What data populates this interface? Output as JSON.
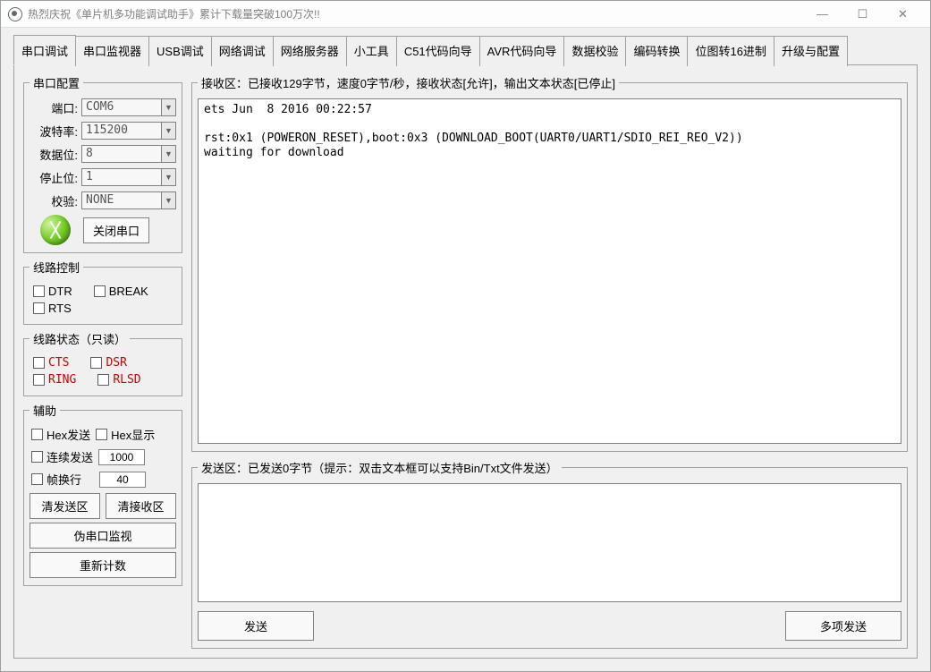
{
  "window": {
    "title": "热烈庆祝《单片机多功能调试助手》累计下载量突破100万次!!"
  },
  "tabs": [
    "串口调试",
    "串口监视器",
    "USB调试",
    "网络调试",
    "网络服务器",
    "小工具",
    "C51代码向导",
    "AVR代码向导",
    "数据校验",
    "编码转换",
    "位图转16进制",
    "升级与配置"
  ],
  "serial_config": {
    "legend": "串口配置",
    "labels": {
      "port": "端口:",
      "baud": "波特率:",
      "databits": "数据位:",
      "stopbits": "停止位:",
      "parity": "校验:"
    },
    "values": {
      "port": "COM6",
      "baud": "115200",
      "databits": "8",
      "stopbits": "1",
      "parity": "NONE"
    },
    "close_btn": "关闭串口"
  },
  "line_control": {
    "legend": "线路控制",
    "items": {
      "dtr": "DTR",
      "break": "BREAK",
      "rts": "RTS"
    }
  },
  "line_status": {
    "legend": "线路状态（只读）",
    "items": {
      "cts": "CTS",
      "dsr": "DSR",
      "ring": "RING",
      "rlsd": "RLSD"
    }
  },
  "aux": {
    "legend": "辅助",
    "hex_send": "Hex发送",
    "hex_show": "Hex显示",
    "cont_send": "连续发送",
    "cont_val": "1000",
    "linewrap": "帧换行",
    "linewrap_val": "40",
    "clear_send": "清发送区",
    "clear_recv": "清接收区",
    "fake_serial": "伪串口监视",
    "recount": "重新计数"
  },
  "recv": {
    "legend": "接收区：已接收129字节，速度0字节/秒，接收状态[允许]，输出文本状态[已停止]",
    "text": "ets Jun  8 2016 00:22:57\n\nrst:0x1 (POWERON_RESET),boot:0x3 (DOWNLOAD_BOOT(UART0/UART1/SDIO_REI_REO_V2))\nwaiting for download"
  },
  "send": {
    "legend": "发送区：已发送0字节（提示：双击文本框可以支持Bin/Txt文件发送）",
    "text": "",
    "send_btn": "发送",
    "multi_btn": "多项发送"
  }
}
